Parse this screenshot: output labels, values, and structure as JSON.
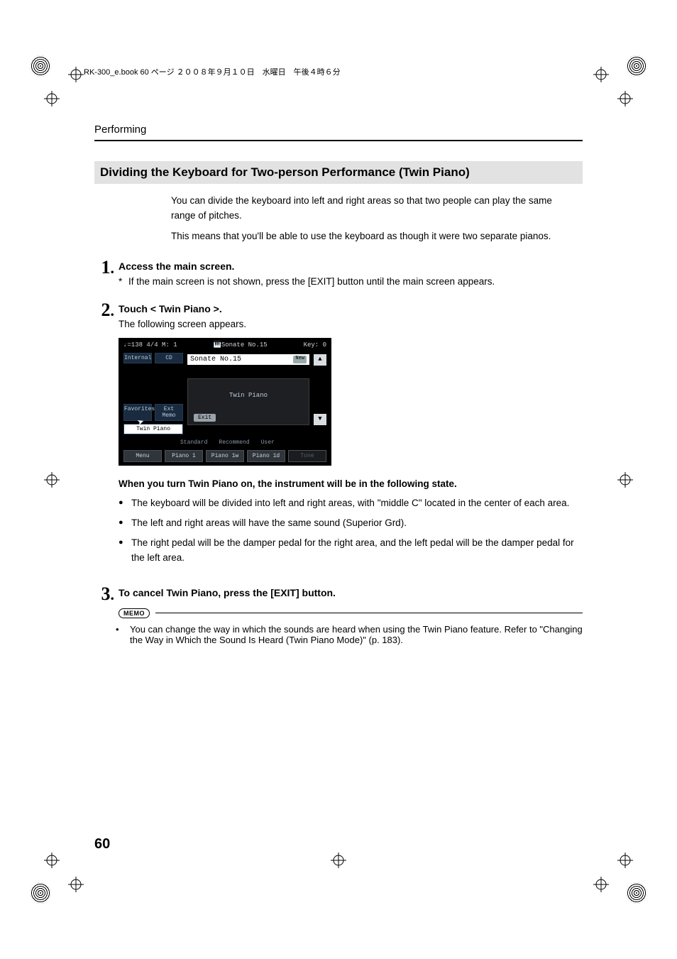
{
  "header_meta": "RK-300_e.book  60 ページ  ２００８年９月１０日　水曜日　午後４時６分",
  "running_head": "Performing",
  "section_heading": "Dividing the Keyboard for Two-person Performance (Twin Piano)",
  "intro": {
    "p1": "You can divide the keyboard into left and right areas so that two people can play the same range of pitches.",
    "p2": "This means that you'll be able to use the keyboard as though it were two separate pianos."
  },
  "steps": {
    "s1": {
      "num": "1",
      "title": "Access the main screen.",
      "note_marker": "*",
      "note": "If the main screen is not shown, press the [EXIT] button until the main screen appears."
    },
    "s2": {
      "num": "2",
      "title": "Touch < Twin Piano >.",
      "after": "The following screen appears."
    },
    "s3": {
      "num": "3",
      "title": "To cancel Twin Piano, press the [EXIT] button."
    }
  },
  "lcd": {
    "top_left": "♩=138   4/4   M:   1",
    "top_center_icon": "🎹",
    "top_center": "Sonate No.15",
    "top_right": "Key: 0",
    "tabs": {
      "internal": "Internal",
      "cd": "CD",
      "favorites": "Favorites",
      "extmem": "Ext Memo",
      "twin": "Twin Piano"
    },
    "field_title": "Sonate No.15",
    "field_chip": "New",
    "popup_title": "Twin Piano",
    "popup_exit": "Exit",
    "up": "▲",
    "down": "▼",
    "cats": {
      "standard": "Standard",
      "recommend": "Recommend",
      "user": "User"
    },
    "bottom": {
      "menu": "Menu",
      "p1": "Piano 1",
      "p1w": "Piano 1w",
      "p1d": "Piano 1d",
      "tone": "Tone"
    }
  },
  "post_image_heading": "When you turn Twin Piano on, the instrument will be in the following state.",
  "bullets": {
    "b1": "The keyboard will be divided into left and right areas, with \"middle C\" located in the center of each area.",
    "b2": "The left and right areas will have the same sound (Superior Grd).",
    "b3": "The right pedal will be the damper pedal for the right area, and the left pedal will be the damper pedal for the left area."
  },
  "memo": {
    "label": "MEMO",
    "bullet_marker": "•",
    "text": "You can change the way in which the sounds are heard when using the Twin Piano feature. Refer to \"Changing the Way in Which the Sound Is Heard (Twin Piano Mode)\" (p. 183)."
  },
  "page_number": "60"
}
